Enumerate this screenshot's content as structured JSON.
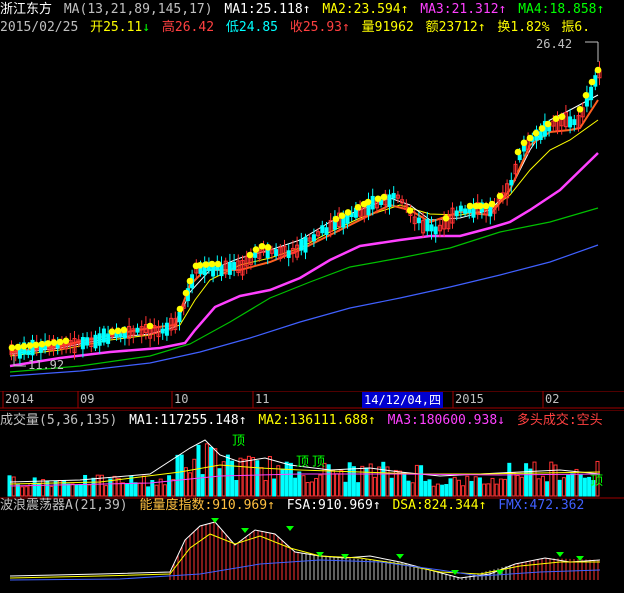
{
  "header": {
    "stock_name": "浙江东方",
    "ma_params": "MA(13,21,89,145,17)",
    "ma1": "MA1:25.118",
    "ma2": "MA2:23.594",
    "ma3": "MA3:21.312",
    "ma4": "MA4:18.858",
    "arrow_up": "↑",
    "arrow_down": "↓"
  },
  "quote": {
    "date": "2015/02/25",
    "open": "开25.11",
    "high": "高26.42",
    "low": "低24.85",
    "close": "收25.93",
    "volume": "量91962",
    "amount": "额23712",
    "turnover": "换1.82%",
    "amplitude": "振6."
  },
  "price_pane": {
    "high_label": "26.42",
    "low_label": "11.92"
  },
  "time_axis": {
    "labels": [
      "2014",
      "09",
      "10",
      "11",
      "2015",
      "02"
    ],
    "cursor_date": "14/12/04,四"
  },
  "volume_pane": {
    "title": "成交量(5,36,135)",
    "ma1": "MA1:117255.148",
    "ma2": "MA2:136111.688",
    "ma3": "MA3:180600.938",
    "signal": "多头成交:空头",
    "tops": [
      "顶",
      "顶",
      "顶",
      "顶"
    ]
  },
  "osc_pane": {
    "title": "波浪震荡器A(21,39)",
    "energy": "能量度指数:910.969",
    "fsa": "FSA:910.969",
    "dsa": "DSA:824.344",
    "fmx": "FMX:472.362"
  },
  "colors": {
    "background": "#000000",
    "up": "#ff3232",
    "down": "#00ffff",
    "ma1": "#ffffff",
    "ma2": "#ffff00",
    "ma3": "#ff00ff",
    "ma4": "#00ff00",
    "ma5": "#4060ff",
    "dots": "#ffff00"
  }
}
